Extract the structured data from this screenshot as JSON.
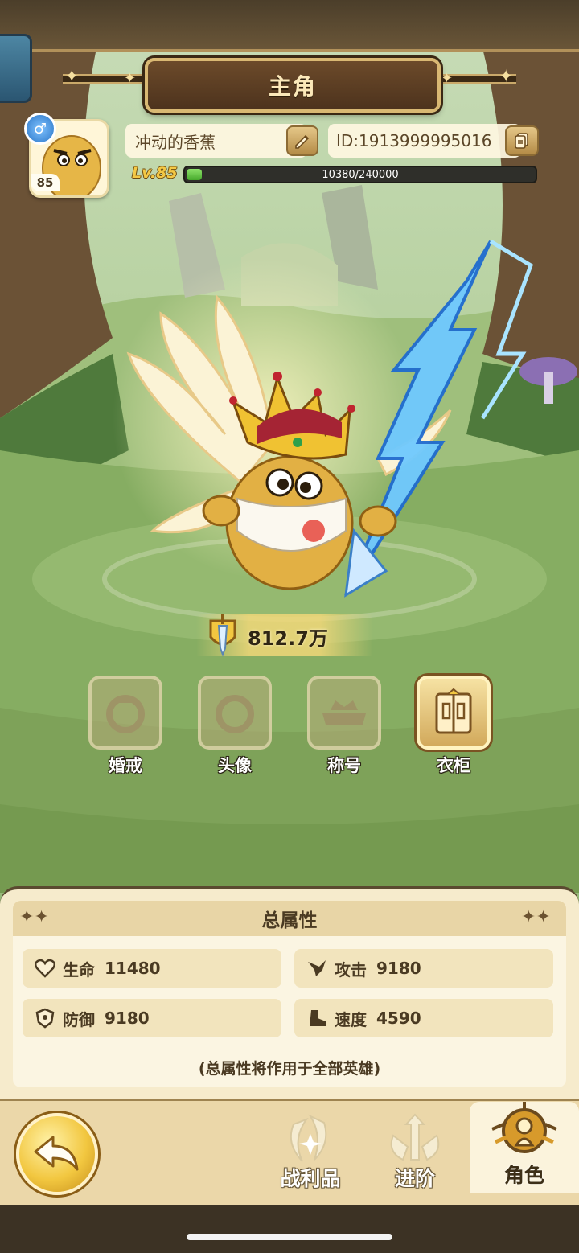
{
  "header": {
    "title": "主角"
  },
  "profile": {
    "gender_symbol": "♂",
    "avatar_level": "85",
    "name": "冲动的香蕉",
    "id_text": "ID:1913999995016",
    "level_text": "Lv.85",
    "exp_text": "10380/240000",
    "exp_fraction": 0.0433
  },
  "power": {
    "value": "812.7万"
  },
  "features": [
    {
      "label": "婚戒",
      "icon": "ring-icon",
      "active": false
    },
    {
      "label": "头像",
      "icon": "avatar-frame-icon",
      "active": false
    },
    {
      "label": "称号",
      "icon": "title-icon",
      "active": false
    },
    {
      "label": "衣柜",
      "icon": "wardrobe-icon",
      "active": true
    }
  ],
  "attributes": {
    "title": "总属性",
    "stats": [
      {
        "icon": "heart-icon",
        "label": "生命",
        "value": "11480"
      },
      {
        "icon": "attack-icon",
        "label": "攻击",
        "value": "9180"
      },
      {
        "icon": "shield-icon",
        "label": "防御",
        "value": "9180"
      },
      {
        "icon": "boot-icon",
        "label": "速度",
        "value": "4590"
      }
    ],
    "note": "(总属性将作用于全部英雄)"
  },
  "nav": {
    "tabs": [
      {
        "label": "战利品",
        "icon": "loot-icon",
        "active": false
      },
      {
        "label": "进阶",
        "icon": "advance-icon",
        "active": false
      },
      {
        "label": "角色",
        "icon": "character-icon",
        "active": true
      }
    ]
  },
  "colors": {
    "panel_bg": "#f6ebcc",
    "accent_gold": "#f2c740",
    "exp_green": "#45a82b"
  }
}
